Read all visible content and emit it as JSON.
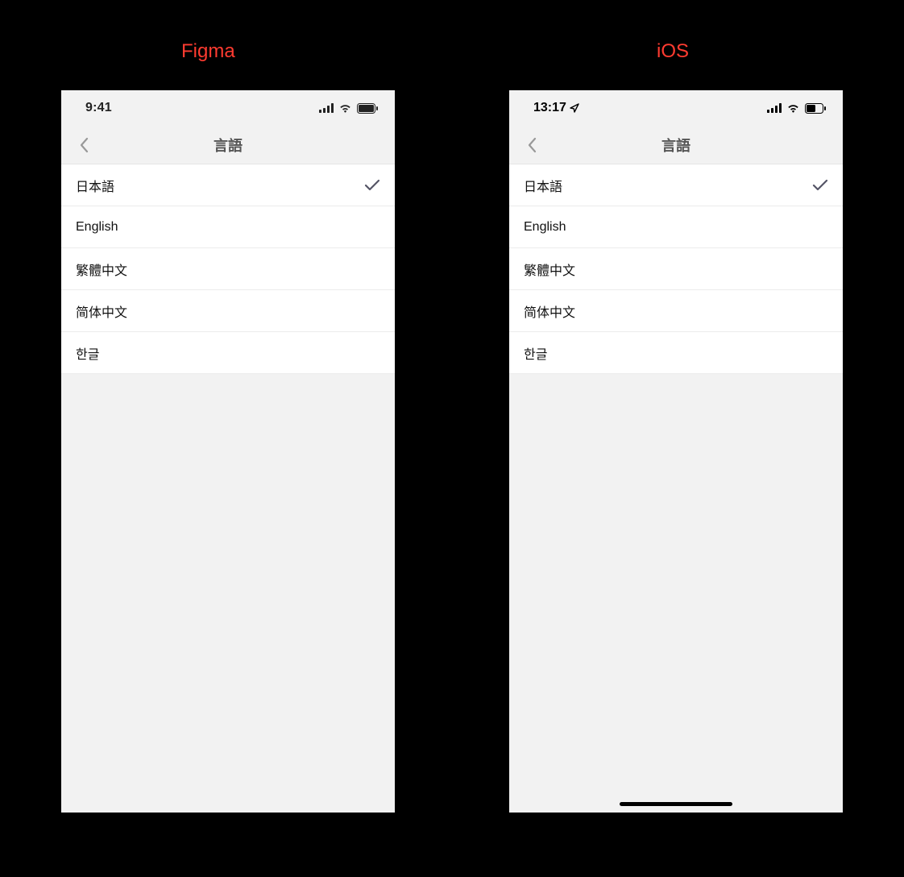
{
  "labels": {
    "figma": "Figma",
    "ios": "iOS"
  },
  "figma": {
    "status_time": "9:41",
    "nav_title": "言語",
    "items": [
      {
        "label": "日本語",
        "selected": true
      },
      {
        "label": "English",
        "selected": false
      },
      {
        "label": "繁體中文",
        "selected": false
      },
      {
        "label": "简体中文",
        "selected": false
      },
      {
        "label": "한글",
        "selected": false
      }
    ]
  },
  "ios": {
    "status_time": "13:17",
    "nav_title": "言語",
    "items": [
      {
        "label": "日本語",
        "selected": true
      },
      {
        "label": "English",
        "selected": false
      },
      {
        "label": "繁體中文",
        "selected": false
      },
      {
        "label": "简体中文",
        "selected": false
      },
      {
        "label": "한글",
        "selected": false
      }
    ]
  }
}
